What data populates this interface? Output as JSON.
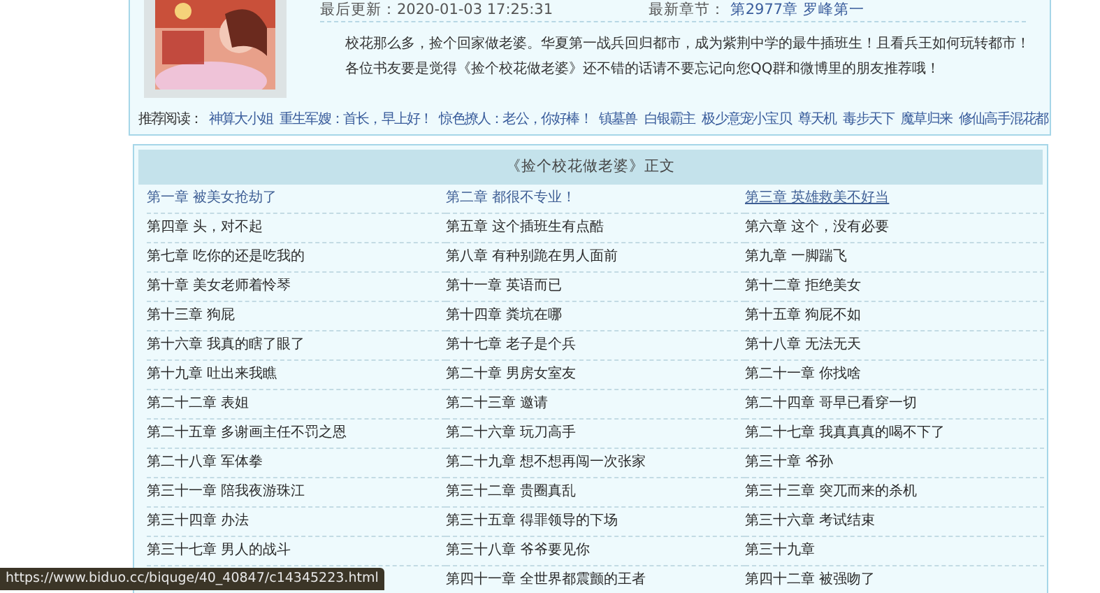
{
  "book": {
    "updated_label": "最后更新：",
    "updated": "2020-01-03 17:25:31",
    "latest_label": "最新章节：",
    "latest": "第2977章 罗峰第一",
    "description": [
      "校花那么多，捡个回家做老婆。华夏第一战兵回归都市，成为紫荆中学的最牛插班生！且看兵王如何玩转都市！",
      "各位书友要是觉得《捡个校花做老婆》还不错的话请不要忘记向您QQ群和微博里的朋友推荐哦！"
    ]
  },
  "recommend": {
    "label": "推荐阅读：",
    "links": [
      "神算大小姐",
      "重生军嫂：首长，早上好！",
      "惊色撩人：老公，你好棒！",
      "镇墓兽",
      "白银霸主",
      "极少意宠小宝贝",
      "尊天机",
      "毒步天下",
      "魔草归来",
      "修仙高手混花都"
    ]
  },
  "chapter_list": {
    "title": "《捡个校花做老婆》正文",
    "chapters": [
      {
        "title": "第一章  被美女抢劫了",
        "visited": true,
        "hovered": false
      },
      {
        "title": "第二章  都很不专业！",
        "visited": true,
        "hovered": false
      },
      {
        "title": "第三章  英雄救美不好当",
        "visited": true,
        "hovered": true
      },
      {
        "title": "第四章  头，对不起",
        "visited": false,
        "hovered": false
      },
      {
        "title": "第五章  这个插班生有点酷",
        "visited": false,
        "hovered": false
      },
      {
        "title": "第六章  这个，没有必要",
        "visited": false,
        "hovered": false
      },
      {
        "title": "第七章  吃你的还是吃我的",
        "visited": false,
        "hovered": false
      },
      {
        "title": "第八章  有种别跪在男人面前",
        "visited": false,
        "hovered": false
      },
      {
        "title": "第九章  一脚踹飞",
        "visited": false,
        "hovered": false
      },
      {
        "title": "第十章  美女老师着怜琴",
        "visited": false,
        "hovered": false
      },
      {
        "title": "第十一章  英语而已",
        "visited": false,
        "hovered": false
      },
      {
        "title": "第十二章  拒绝美女",
        "visited": false,
        "hovered": false
      },
      {
        "title": "第十三章  狗屁",
        "visited": false,
        "hovered": false
      },
      {
        "title": "第十四章  粪坑在哪",
        "visited": false,
        "hovered": false
      },
      {
        "title": "第十五章  狗屁不如",
        "visited": false,
        "hovered": false
      },
      {
        "title": "第十六章  我真的瞎了眼了",
        "visited": false,
        "hovered": false
      },
      {
        "title": "第十七章  老子是个兵",
        "visited": false,
        "hovered": false
      },
      {
        "title": "第十八章  无法无天",
        "visited": false,
        "hovered": false
      },
      {
        "title": "第十九章  吐出来我瞧",
        "visited": false,
        "hovered": false
      },
      {
        "title": "第二十章  男房女室友",
        "visited": false,
        "hovered": false
      },
      {
        "title": "第二十一章  你找啥",
        "visited": false,
        "hovered": false
      },
      {
        "title": "第二十二章  表姐",
        "visited": false,
        "hovered": false
      },
      {
        "title": "第二十三章  邀请",
        "visited": false,
        "hovered": false
      },
      {
        "title": "第二十四章  哥早已看穿一切",
        "visited": false,
        "hovered": false
      },
      {
        "title": "第二十五章  多谢画主任不罚之恩",
        "visited": false,
        "hovered": false
      },
      {
        "title": "第二十六章  玩刀高手",
        "visited": false,
        "hovered": false
      },
      {
        "title": "第二十七章  我真真真的喝不下了",
        "visited": false,
        "hovered": false
      },
      {
        "title": "第二十八章  军体拳",
        "visited": false,
        "hovered": false
      },
      {
        "title": "第二十九章  想不想再闯一次张家",
        "visited": false,
        "hovered": false
      },
      {
        "title": "第三十章  爷孙",
        "visited": false,
        "hovered": false
      },
      {
        "title": "第三十一章  陪我夜游珠江",
        "visited": false,
        "hovered": false
      },
      {
        "title": "第三十二章  贵圈真乱",
        "visited": false,
        "hovered": false
      },
      {
        "title": "第三十三章  突兀而来的杀机",
        "visited": false,
        "hovered": false
      },
      {
        "title": "第三十四章  办法",
        "visited": false,
        "hovered": false
      },
      {
        "title": "第三十五章  得罪领导的下场",
        "visited": false,
        "hovered": false
      },
      {
        "title": "第三十六章  考试结束",
        "visited": false,
        "hovered": false
      },
      {
        "title": "第三十七章  男人的战斗",
        "visited": false,
        "hovered": false
      },
      {
        "title": "第三十八章  爷爷要见你",
        "visited": false,
        "hovered": false
      },
      {
        "title": "第三十九章",
        "visited": false,
        "hovered": false
      },
      {
        "title": "第四十一章  全世界都震颤的王者",
        "visited": false,
        "hovered": false
      },
      {
        "title": "第四十二章  被强吻了",
        "visited": false,
        "hovered": false
      }
    ]
  },
  "status_bar": {
    "url": "https://www.biduo.cc/biquge/40_40847/c14345223.html"
  }
}
